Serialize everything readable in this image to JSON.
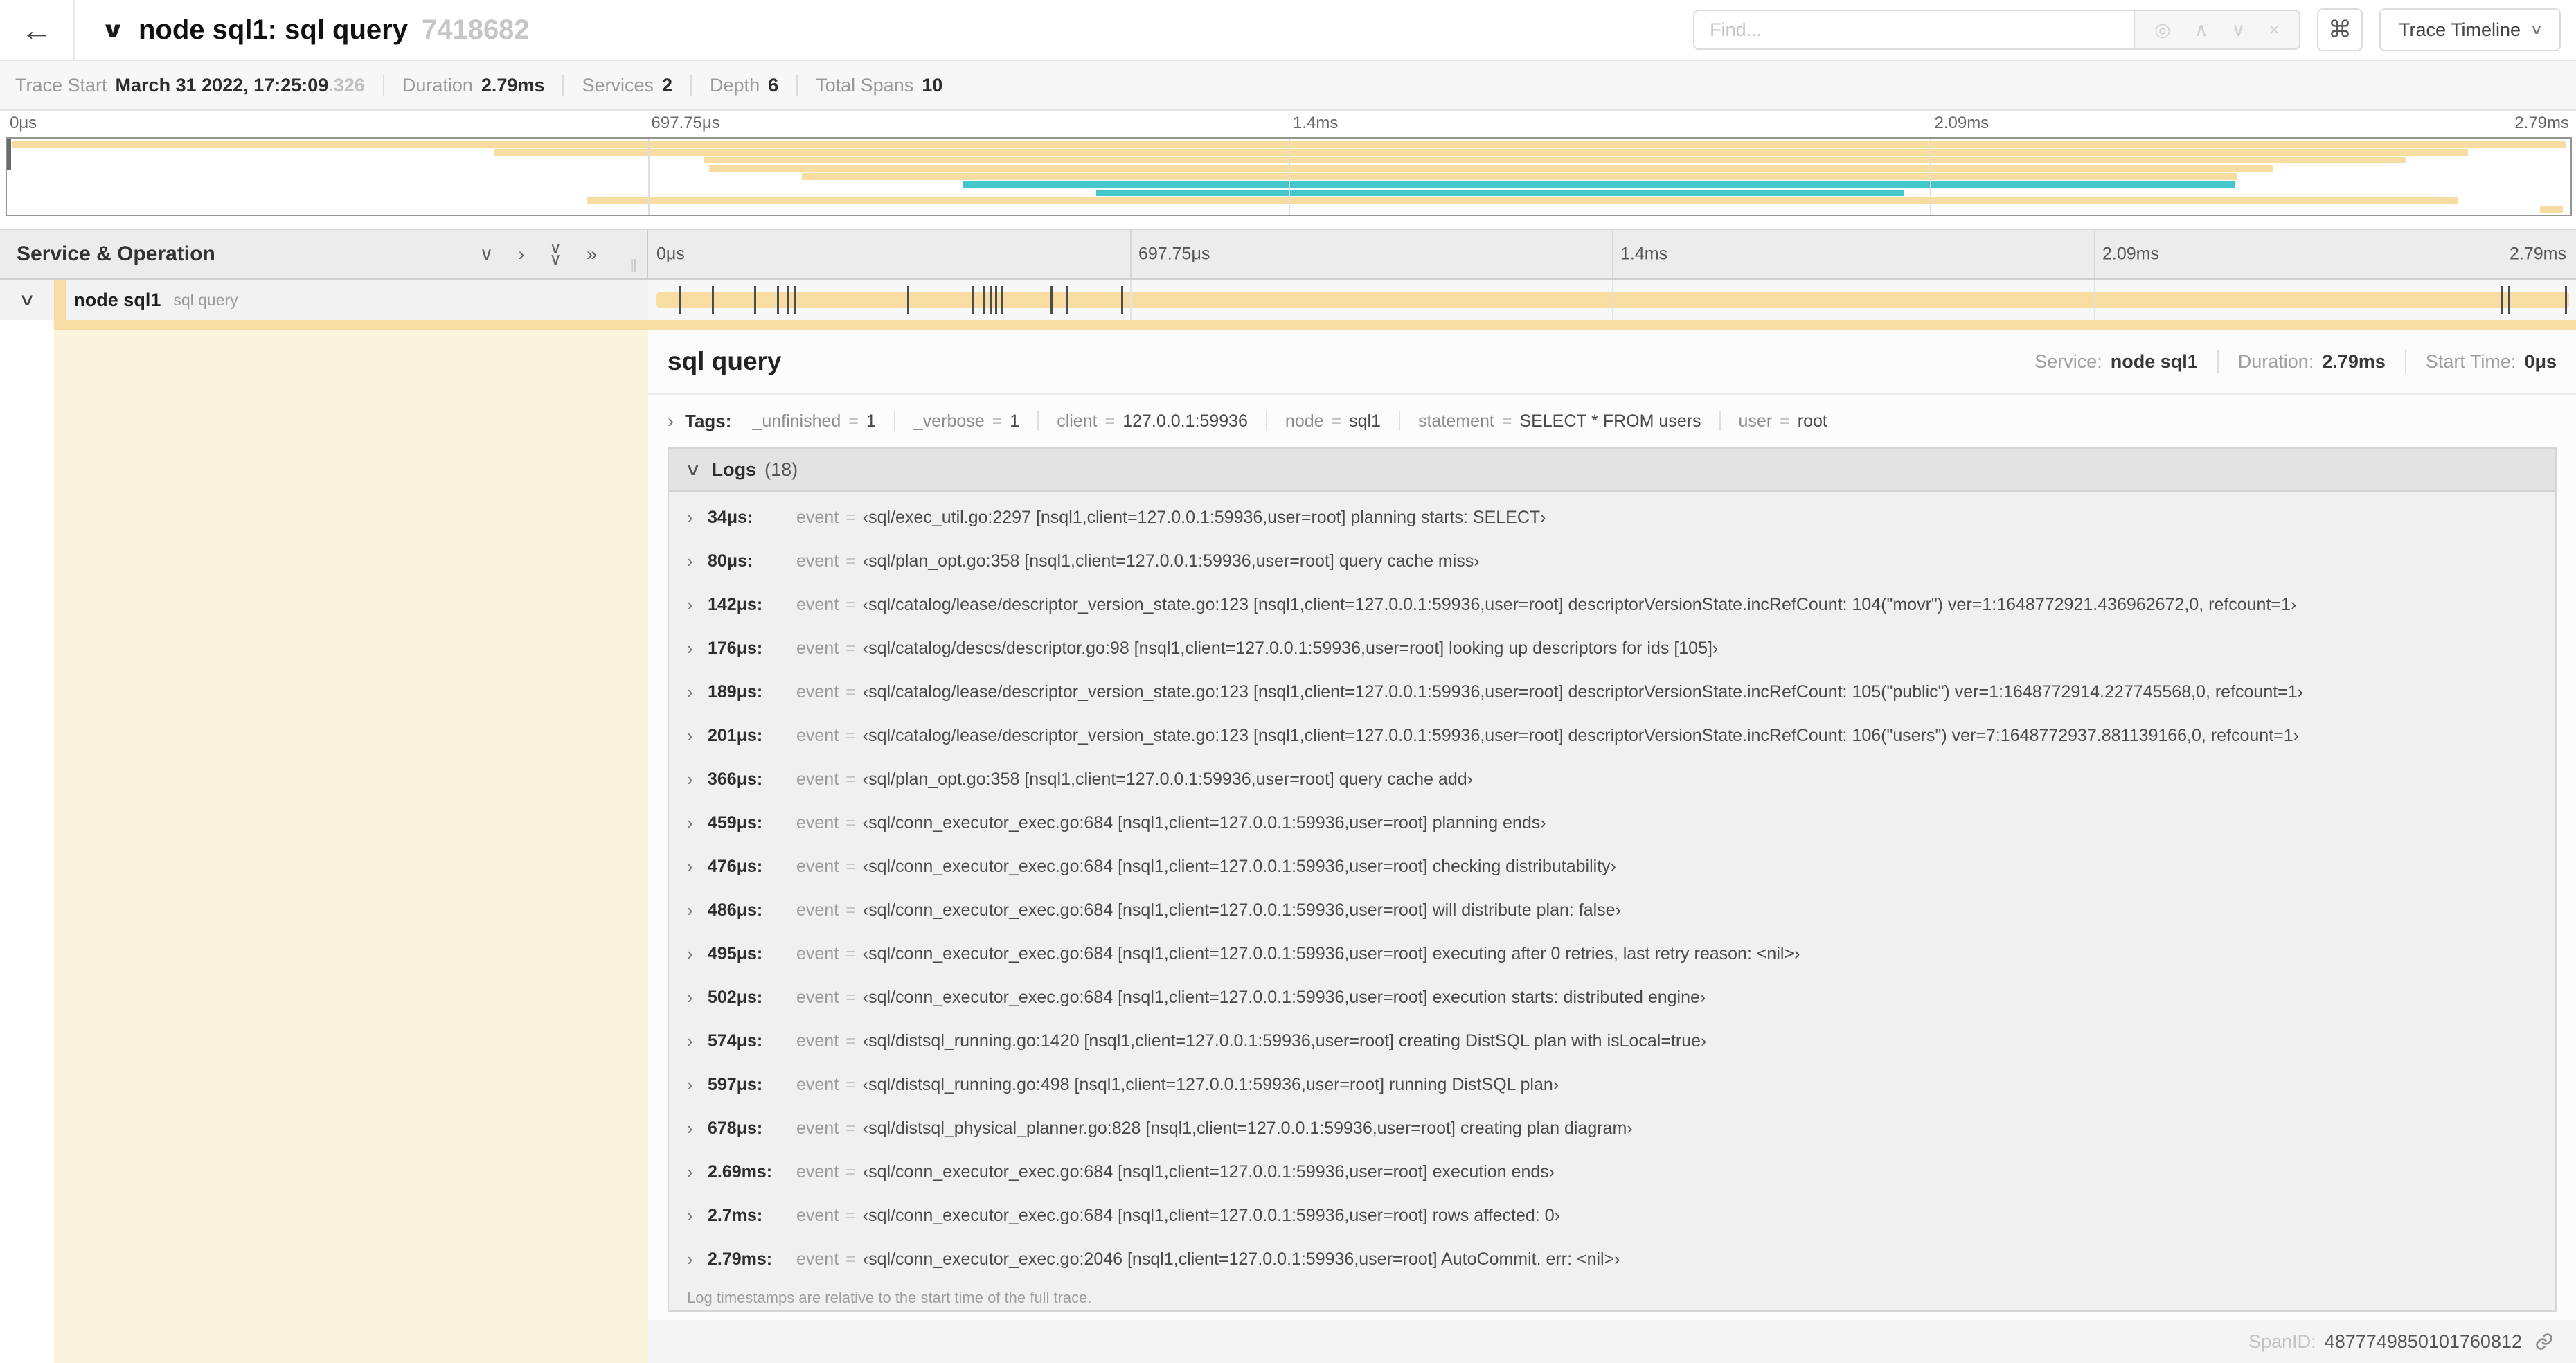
{
  "colors": {
    "span_tan": "#f8dda2",
    "span_teal": "#45c6ca",
    "accent_cream": "#fcf3dc"
  },
  "nav": {
    "back_icon": "←",
    "collapse_icon": "∨",
    "title": "node sql1: sql query",
    "trace_id": "7418682",
    "find_placeholder": "Find...",
    "find_tools": {
      "locate_icon": "◎",
      "prev_icon": "∧",
      "next_icon": "∨",
      "clear_icon": "×"
    },
    "shortcut_icon": "⌘",
    "view_selector": "Trace Timeline",
    "view_selector_caret": "∨"
  },
  "summary": {
    "items": [
      {
        "label": "Trace Start",
        "value": "March 31 2022, 17:25:09",
        "suffix": ".326"
      },
      {
        "label": "Duration",
        "value": "2.79ms"
      },
      {
        "label": "Services",
        "value": "2"
      },
      {
        "label": "Depth",
        "value": "6"
      },
      {
        "label": "Total Spans",
        "value": "10"
      }
    ]
  },
  "minimap": {
    "ticks": [
      {
        "label": "0μs",
        "pos": 0
      },
      {
        "label": "697.75μs",
        "pos": 25
      },
      {
        "label": "1.4ms",
        "pos": 50
      },
      {
        "label": "2.09ms",
        "pos": 75
      },
      {
        "label": "2.79ms",
        "pos": 100
      }
    ],
    "gridlines": [
      25,
      50,
      75
    ],
    "rows": [
      {
        "start": 0.2,
        "end": 99.8,
        "color": "tan"
      },
      {
        "start": 19,
        "end": 96,
        "color": "tan"
      },
      {
        "start": 27.2,
        "end": 93.6,
        "color": "tan"
      },
      {
        "start": 27.4,
        "end": 88.4,
        "color": "tan"
      },
      {
        "start": 31,
        "end": 87,
        "color": "tan"
      },
      {
        "start": 37.3,
        "end": 86.9,
        "color": "teal"
      },
      {
        "start": 42.5,
        "end": 74,
        "color": "teal"
      },
      {
        "start": 22.6,
        "end": 95.6,
        "color": "tan"
      },
      {
        "start": 98.8,
        "end": 99.7,
        "color": "tan"
      }
    ]
  },
  "timeline": {
    "header_label": "Service & Operation",
    "collapse_icons": {
      "collapse_one": "∨",
      "expand_one": "›",
      "collapse_all_glyph": "∨",
      "expand_all": "»",
      "resize_glyph": "‖"
    },
    "ticks": [
      {
        "label": "0μs",
        "pos": 0
      },
      {
        "label": "697.75μs",
        "pos": 25
      },
      {
        "label": "1.4ms",
        "pos": 50
      },
      {
        "label": "2.09ms",
        "pos": 75
      },
      {
        "label": "2.79ms",
        "pos": 100
      }
    ],
    "gridlines": [
      25,
      50,
      75
    ],
    "row": {
      "expander": "∨",
      "service": "node sql1",
      "operation": "sql query",
      "bar": {
        "start_pct": 0,
        "end_pct": 100,
        "color": "tan"
      },
      "marker_positions_pct": [
        1.2,
        2.9,
        5.1,
        6.3,
        6.8,
        7.2,
        13.1,
        16.5,
        17.1,
        17.4,
        17.7,
        18,
        20.6,
        21.4,
        24.3,
        96.4,
        96.8,
        99.8
      ]
    }
  },
  "detail": {
    "title": "sql query",
    "overview": [
      {
        "label": "Service:",
        "value": "node sql1"
      },
      {
        "label": "Duration:",
        "value": "2.79ms"
      },
      {
        "label": "Start Time:",
        "value": "0μs"
      }
    ],
    "tags": {
      "expander": "›",
      "label": "Tags:",
      "items": [
        {
          "key": "_unfinished",
          "value": "1"
        },
        {
          "key": "_verbose",
          "value": "1"
        },
        {
          "key": "client",
          "value": "127.0.0.1:59936"
        },
        {
          "key": "node",
          "value": "sql1"
        },
        {
          "key": "statement",
          "value": "SELECT * FROM users"
        },
        {
          "key": "user",
          "value": "root"
        }
      ]
    },
    "logs": {
      "expander": "∨",
      "label": "Logs",
      "count": "(18)",
      "entries": [
        {
          "time": "34μs:",
          "key": "event",
          "value": "‹sql/exec_util.go:2297 [nsql1,client=127.0.0.1:59936,user=root] planning starts: SELECT›"
        },
        {
          "time": "80μs:",
          "key": "event",
          "value": "‹sql/plan_opt.go:358 [nsql1,client=127.0.0.1:59936,user=root] query cache miss›"
        },
        {
          "time": "142μs:",
          "key": "event",
          "value": "‹sql/catalog/lease/descriptor_version_state.go:123 [nsql1,client=127.0.0.1:59936,user=root] descriptorVersionState.incRefCount: 104(\"movr\") ver=1:1648772921.436962672,0, refcount=1›"
        },
        {
          "time": "176μs:",
          "key": "event",
          "value": "‹sql/catalog/descs/descriptor.go:98 [nsql1,client=127.0.0.1:59936,user=root] looking up descriptors for ids [105]›"
        },
        {
          "time": "189μs:",
          "key": "event",
          "value": "‹sql/catalog/lease/descriptor_version_state.go:123 [nsql1,client=127.0.0.1:59936,user=root] descriptorVersionState.incRefCount: 105(\"public\") ver=1:1648772914.227745568,0, refcount=1›"
        },
        {
          "time": "201μs:",
          "key": "event",
          "value": "‹sql/catalog/lease/descriptor_version_state.go:123 [nsql1,client=127.0.0.1:59936,user=root] descriptorVersionState.incRefCount: 106(\"users\") ver=7:1648772937.881139166,0, refcount=1›"
        },
        {
          "time": "366μs:",
          "key": "event",
          "value": "‹sql/plan_opt.go:358 [nsql1,client=127.0.0.1:59936,user=root] query cache add›"
        },
        {
          "time": "459μs:",
          "key": "event",
          "value": "‹sql/conn_executor_exec.go:684 [nsql1,client=127.0.0.1:59936,user=root] planning ends›"
        },
        {
          "time": "476μs:",
          "key": "event",
          "value": "‹sql/conn_executor_exec.go:684 [nsql1,client=127.0.0.1:59936,user=root] checking distributability›"
        },
        {
          "time": "486μs:",
          "key": "event",
          "value": "‹sql/conn_executor_exec.go:684 [nsql1,client=127.0.0.1:59936,user=root] will distribute plan: false›"
        },
        {
          "time": "495μs:",
          "key": "event",
          "value": "‹sql/conn_executor_exec.go:684 [nsql1,client=127.0.0.1:59936,user=root] executing after 0 retries, last retry reason: <nil>›"
        },
        {
          "time": "502μs:",
          "key": "event",
          "value": "‹sql/conn_executor_exec.go:684 [nsql1,client=127.0.0.1:59936,user=root] execution starts: distributed engine›"
        },
        {
          "time": "574μs:",
          "key": "event",
          "value": "‹sql/distsql_running.go:1420 [nsql1,client=127.0.0.1:59936,user=root] creating DistSQL plan with isLocal=true›"
        },
        {
          "time": "597μs:",
          "key": "event",
          "value": "‹sql/distsql_running.go:498 [nsql1,client=127.0.0.1:59936,user=root] running DistSQL plan›"
        },
        {
          "time": "678μs:",
          "key": "event",
          "value": "‹sql/distsql_physical_planner.go:828 [nsql1,client=127.0.0.1:59936,user=root] creating plan diagram›"
        },
        {
          "time": "2.69ms:",
          "key": "event",
          "value": "‹sql/conn_executor_exec.go:684 [nsql1,client=127.0.0.1:59936,user=root] execution ends›"
        },
        {
          "time": "2.7ms:",
          "key": "event",
          "value": "‹sql/conn_executor_exec.go:684 [nsql1,client=127.0.0.1:59936,user=root] rows affected: 0›"
        },
        {
          "time": "2.79ms:",
          "key": "event",
          "value": "‹sql/conn_executor_exec.go:2046 [nsql1,client=127.0.0.1:59936,user=root] AutoCommit. err: <nil>›"
        }
      ],
      "footer": "Log timestamps are relative to the start time of the full trace."
    },
    "span_id": {
      "label": "SpanID:",
      "value": "4877749850101760812"
    }
  }
}
